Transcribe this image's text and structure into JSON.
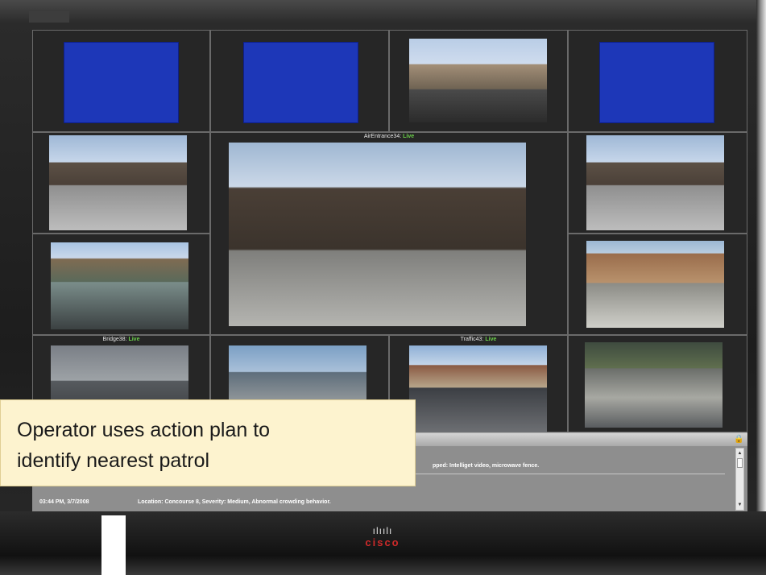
{
  "monitor": {
    "brand": "cisco",
    "brand_mark": "ılıılı"
  },
  "video_wall": {
    "featured": {
      "camera": "AirEntrance34:",
      "status": "Live"
    },
    "captions": [
      {
        "camera": "Bridge38:",
        "status": "Live"
      },
      {
        "camera": "Traffic43:",
        "status": "Live"
      }
    ],
    "live_color": "#6bd04a",
    "no_signal_color": "#1d37b8"
  },
  "events": {
    "rows": [
      {
        "time": "",
        "text": "pped: Intelliget video, microwave fence."
      },
      {
        "time": "03:44 PM, 3/7/2008",
        "text": "Location: Concourse 8, Severity: Medium, Abnormal crowding behavior."
      }
    ]
  },
  "callout": {
    "line1": "Operator uses action plan to",
    "line2": "identify nearest patrol"
  }
}
